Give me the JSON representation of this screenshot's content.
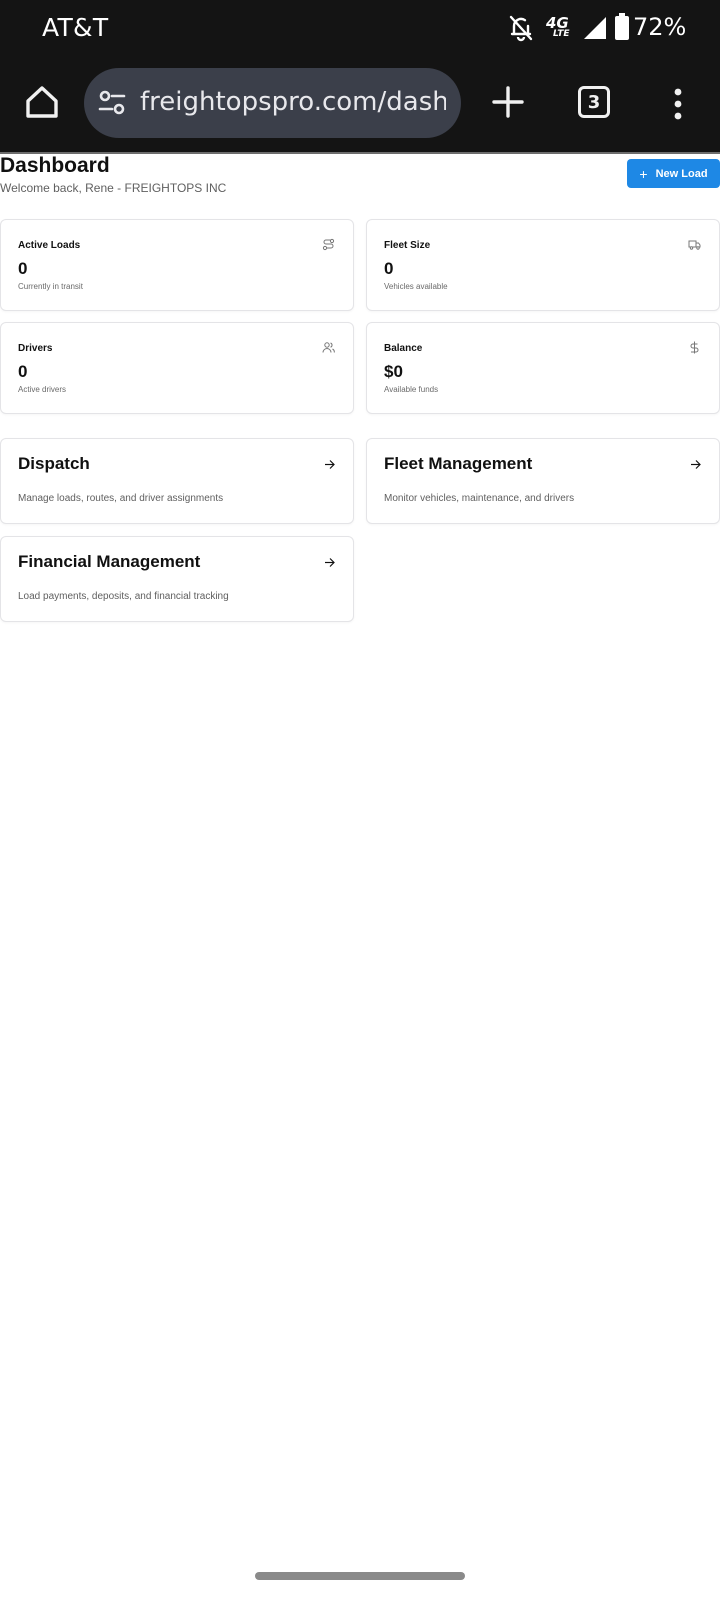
{
  "status_bar": {
    "carrier": "AT&T",
    "network_label": "4G",
    "network_sub": "LTE",
    "battery_percent": "72%",
    "icons": [
      "bell-off-icon",
      "signal-icon",
      "battery-icon"
    ]
  },
  "browser": {
    "url": "freightopspro.com/dashl",
    "tab_count": "3",
    "icons": [
      "home-icon",
      "tune-icon",
      "plus-icon",
      "more-vert-icon"
    ]
  },
  "header": {
    "title": "Dashboard",
    "subtitle": "Welcome back, Rene - FREIGHTOPS INC",
    "new_load_label": "New Load",
    "accent_color": "#1e88e5"
  },
  "stats": [
    {
      "label": "Active Loads",
      "value": "0",
      "note": "Currently in transit",
      "icon": "route-icon"
    },
    {
      "label": "Fleet Size",
      "value": "0",
      "note": "Vehicles available",
      "icon": "truck-icon"
    },
    {
      "label": "Drivers",
      "value": "0",
      "note": "Active drivers",
      "icon": "users-icon"
    },
    {
      "label": "Balance",
      "value": "$0",
      "note": "Available funds",
      "icon": "dollar-icon"
    }
  ],
  "modules": [
    {
      "title": "Dispatch",
      "description": "Manage loads, routes, and driver assignments"
    },
    {
      "title": "Fleet Management",
      "description": "Monitor vehicles, maintenance, and drivers"
    },
    {
      "title": "Financial Management",
      "description": "Load payments, deposits, and financial tracking"
    }
  ]
}
